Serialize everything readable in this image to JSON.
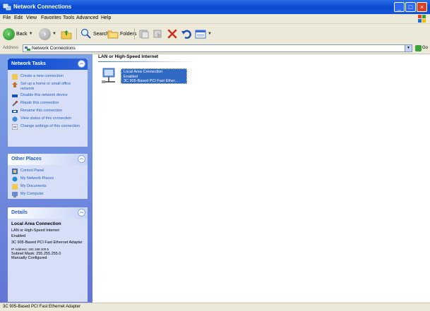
{
  "window": {
    "title": "Network Connections"
  },
  "menu": [
    "File",
    "Edit",
    "View",
    "Favorites",
    "Tools",
    "Advanced",
    "Help"
  ],
  "toolbar": {
    "back_label": "Back",
    "search_label": "Search",
    "folders_label": "Folders"
  },
  "address": {
    "label": "Address",
    "value": "Network Connections",
    "go_label": "Go"
  },
  "network_tasks": {
    "title": "Network Tasks",
    "items": [
      "Create a new connection",
      "Set up a home or small office network",
      "Disable this network device",
      "Repair this connection",
      "Rename this connection",
      "View status of this connection",
      "Change settings of this connection"
    ]
  },
  "other_places": {
    "title": "Other Places",
    "items": [
      "Control Panel",
      "My Network Places",
      "My Documents",
      "My Computer"
    ]
  },
  "details": {
    "title": "Details",
    "name": "Local Area Connection",
    "lines": [
      "LAN or High-Speed Internet",
      "Enabled",
      "3C 905-Based PCI Fast Ethernet Adapter",
      "IP Address: 192.168.100.5",
      "Subnet Mask: 255.255.255.0",
      "Manually Configured"
    ]
  },
  "content": {
    "group_title": "LAN or High-Speed Internet",
    "connection": {
      "name": "Local Area Connection",
      "status": "Enabled",
      "device": "3C 905-Based PCI Fast Ether..."
    }
  },
  "statusbar": {
    "text": "3C 905-Based PCI Fast Ethernet Adapter"
  }
}
